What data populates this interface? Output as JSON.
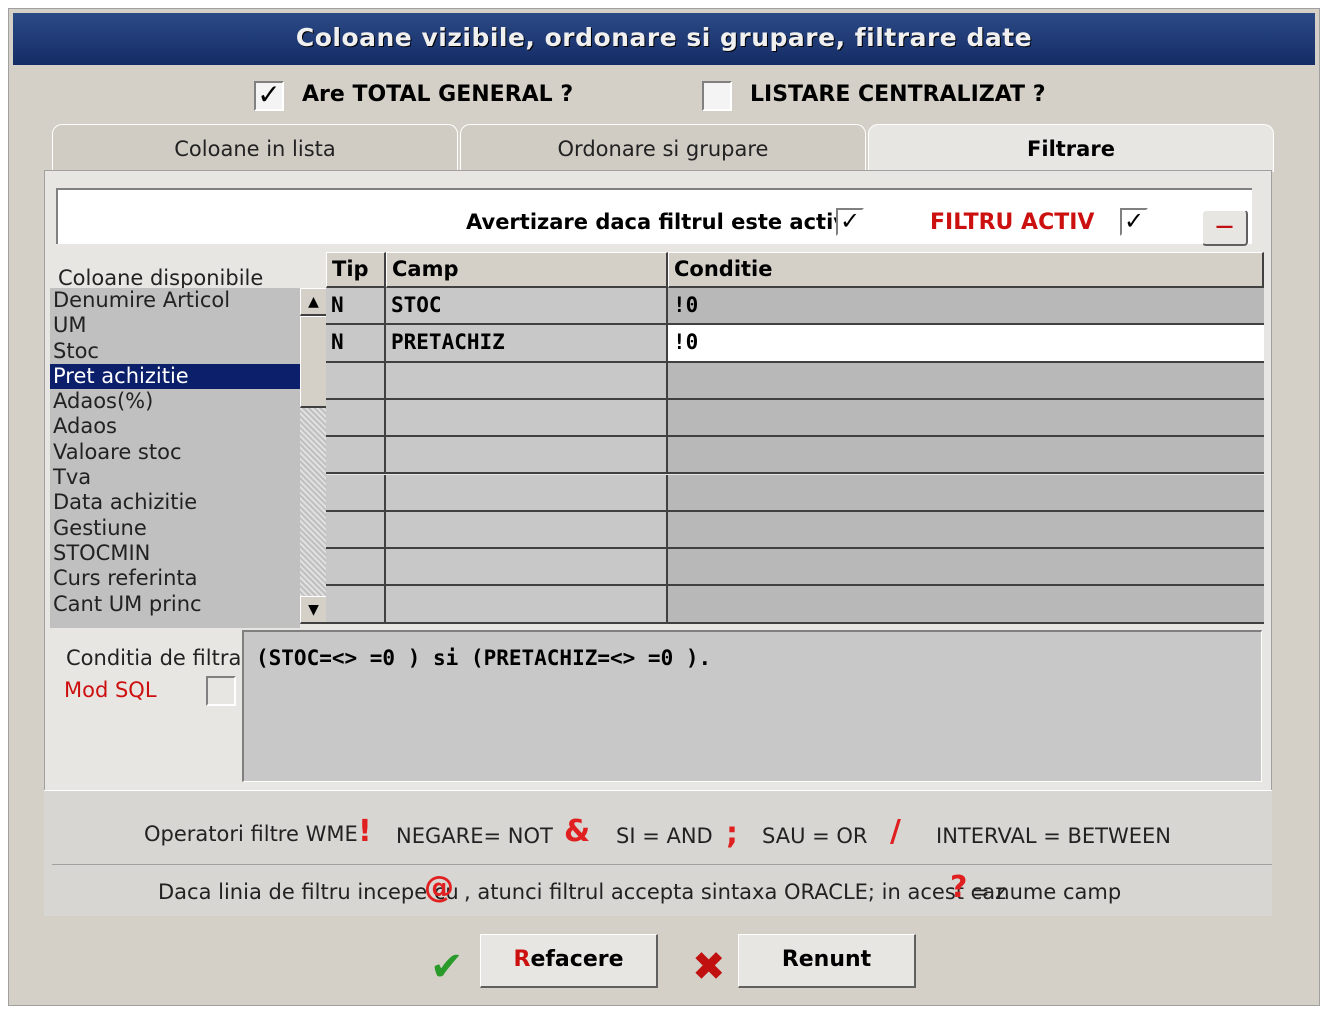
{
  "window": {
    "title": "Coloane vizibile, ordonare si grupare, filtrare date"
  },
  "options": {
    "total_general_label": "Are TOTAL GENERAL ?",
    "total_general_checked": "✓",
    "listare_label": "LISTARE CENTRALIZAT ?",
    "listare_checked": ""
  },
  "tabs": [
    {
      "label": "Coloane in lista"
    },
    {
      "label": "Ordonare si grupare"
    },
    {
      "label": "Filtrare"
    }
  ],
  "filter_bar": {
    "warn_label": "Avertizare daca filtrul este activ",
    "warn_checked": "✓",
    "active_label": "FILTRU ACTIV",
    "active_checked": "✓",
    "active_color": "#cc1010",
    "remove_button": "—"
  },
  "columns": {
    "header": "Coloane disponibile",
    "items": [
      "Denumire Articol",
      "UM",
      "Stoc",
      "Pret achizitie",
      "Adaos(%)",
      "Adaos",
      "Valoare stoc",
      "Tva",
      "Data achizitie",
      "Gestiune",
      "STOCMIN",
      "Curs referinta",
      "Cant UM princ"
    ],
    "selected": "Pret achizitie"
  },
  "grid": {
    "headers": [
      "Tip",
      "Camp",
      "Conditie"
    ],
    "rows": [
      [
        "N",
        "STOC",
        "!0"
      ],
      [
        "N",
        "PRETACHIZ",
        "!0"
      ],
      [
        "",
        "",
        ""
      ],
      [
        "",
        "",
        ""
      ],
      [
        "",
        "",
        ""
      ],
      [
        "",
        "",
        ""
      ],
      [
        "",
        "",
        ""
      ],
      [
        "",
        "",
        ""
      ],
      [
        "",
        "",
        ""
      ]
    ]
  },
  "condition": {
    "label": "Conditia de filtrare:",
    "sql_label": "Mod SQL",
    "sql_checked": "",
    "text": "(STOC=<> =0 ) si (PRETACHIZ=<> =0 )."
  },
  "operators": {
    "title": "Operatori filtre WME",
    "items": [
      {
        "symbol": "!",
        "text": "NEGARE= NOT"
      },
      {
        "symbol": "&",
        "text": "SI = AND"
      },
      {
        "symbol": ";",
        "text": "SAU = OR"
      },
      {
        "symbol": "/",
        "text": "INTERVAL = BETWEEN"
      }
    ],
    "oracle_before": "Daca linia de filtru incepe cu",
    "oracle_symbol": "@",
    "oracle_middle": ", atunci filtrul accepta sintaxa ORACLE; in acest caz",
    "oracle_q": "?",
    "oracle_after": "= nume camp"
  },
  "buttons": {
    "ok_icon": "✔",
    "ok_label_first": "R",
    "ok_label_rest": "efacere",
    "cancel_icon": "✖",
    "cancel_label": "Renunt"
  }
}
